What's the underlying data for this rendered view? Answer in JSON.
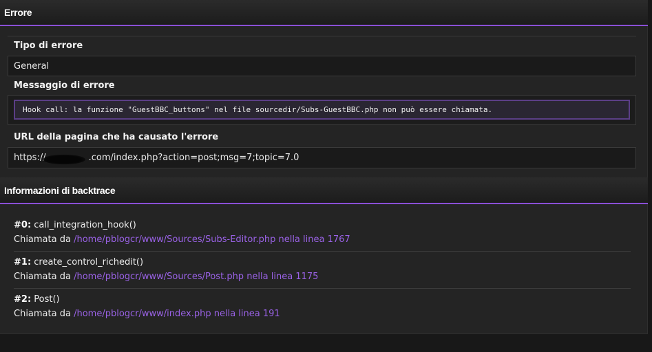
{
  "error_section": {
    "title": "Errore",
    "type_label": "Tipo di errore",
    "type_value": "General",
    "message_label": "Messaggio di errore",
    "message_value": "Hook call: la funzione \"GuestBBC_buttons\" nel file sourcedir/Subs-GuestBBC.php non può essere chiamata.",
    "url_label": "URL della pagina che ha causato l'errore",
    "url_prefix": "https://",
    "url_suffix": ".com/index.php?action=post;msg=7;topic=7.0"
  },
  "backtrace_section": {
    "title": "Informazioni di backtrace",
    "called_from_label": "Chiamata da",
    "entries": [
      {
        "index": "#0:",
        "function": "call_integration_hook()",
        "location": "/home/pblogcr/www/Sources/Subs-Editor.php nella linea 1767"
      },
      {
        "index": "#1:",
        "function": "create_control_richedit()",
        "location": "/home/pblogcr/www/Sources/Post.php nella linea 1175"
      },
      {
        "index": "#2:",
        "function": "Post()",
        "location": "/home/pblogcr/www/index.php nella linea 191"
      }
    ]
  },
  "colors": {
    "accent": "#8a4fd6",
    "link": "#9a62e6",
    "background": "#181818",
    "panel": "#242424"
  }
}
